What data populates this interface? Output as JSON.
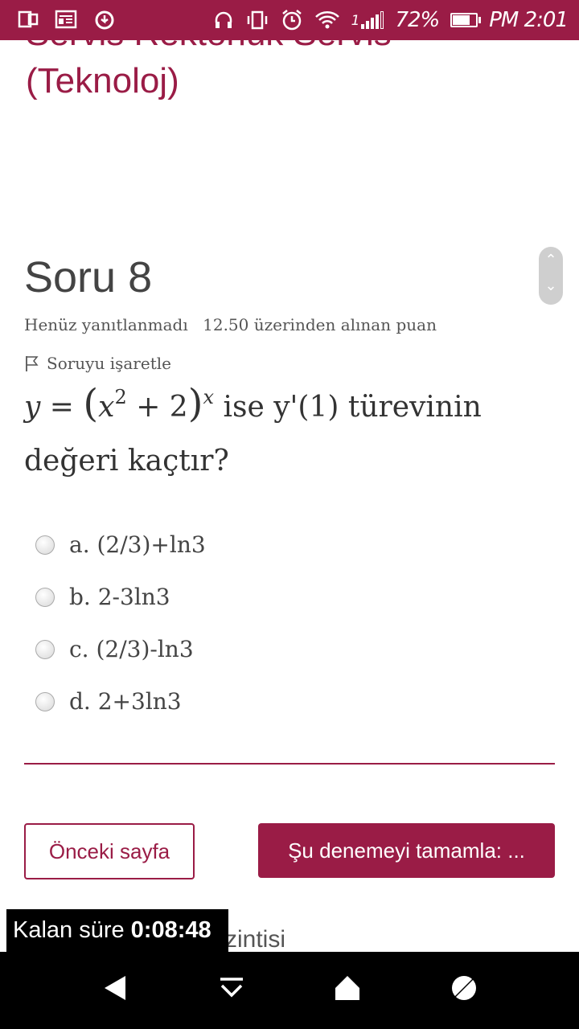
{
  "status_bar": {
    "battery": "72%",
    "time": "PM 2:01",
    "signal": "1"
  },
  "course": {
    "cut_title": "Servis Rektörlük Servis",
    "title": "(Teknoloj)"
  },
  "question": {
    "number_label": "Soru 8",
    "state": "Henüz yanıtlanmadı",
    "grade": "12.50 üzerinden alınan puan",
    "flag_label": "Soruyu işaretle",
    "text_after": " ise y'(1) türevinin",
    "text_line2": "değeri kaçtır?",
    "formula": {
      "y": "y",
      "eq": "=",
      "base": "x",
      "base_exp": "2",
      "plus_two": "+ 2",
      "exponent": "x"
    }
  },
  "answers": [
    {
      "label": "a. (2/3)+ln3"
    },
    {
      "label": "b. 2-3ln3"
    },
    {
      "label": "c. (2/3)-ln3"
    },
    {
      "label": "d. 2+3ln3"
    }
  ],
  "buttons": {
    "previous": "Önceki sayfa",
    "finish": "Şu denemeyi tamamla: ..."
  },
  "nav_peek": "zintisi",
  "timer": {
    "label": "Kalan süre",
    "value": "0:08:48"
  },
  "colors": {
    "brand": "#9a1c46"
  }
}
